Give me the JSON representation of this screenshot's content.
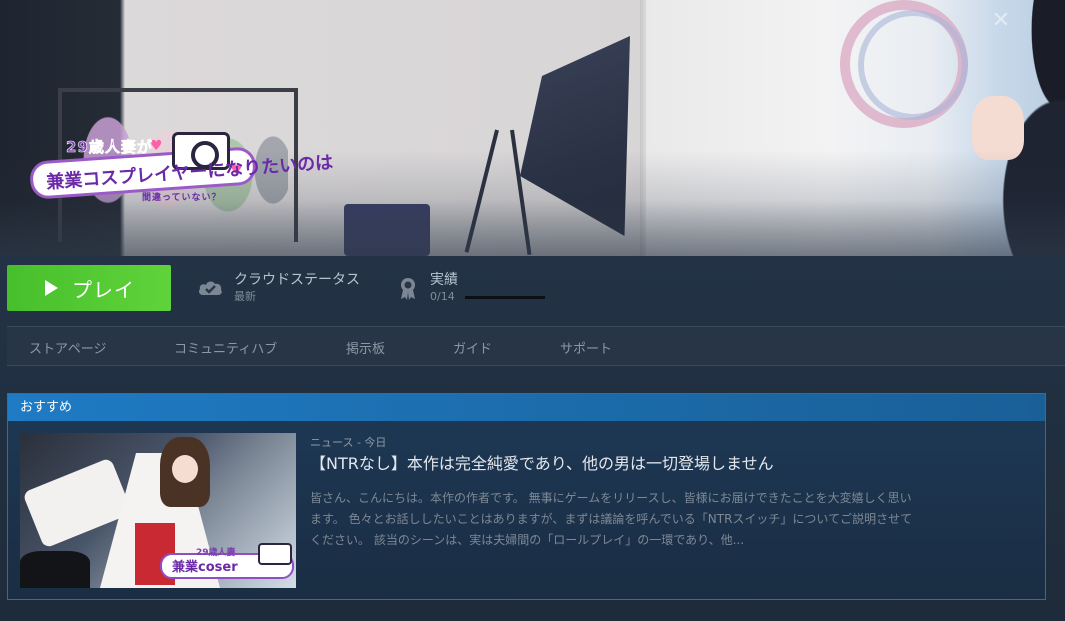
{
  "hero": {
    "close_icon": "close-icon",
    "logo": {
      "line1": "29歳人妻が",
      "line2": "兼業コスプレイヤーになりたいのは",
      "line3": "間違っていない？"
    }
  },
  "actions": {
    "play_label": "プレイ",
    "play_icon": "play-icon",
    "cloud_status_label": "クラウドステータス",
    "cloud_status_value": "最新",
    "cloud_icon": "cloud-check-icon",
    "achievements_label": "実績",
    "achievements_value": "0/14",
    "achievements_progress": 0,
    "achievements_icon": "achievement-badge-icon"
  },
  "tabs": [
    {
      "label": "ストアページ"
    },
    {
      "label": "コミュニティハブ"
    },
    {
      "label": "掲示板"
    },
    {
      "label": "ガイド"
    },
    {
      "label": "サポート"
    }
  ],
  "featured": {
    "header": "おすすめ",
    "thumbnail_logo": {
      "line1": "29歳人妻",
      "line2": "兼業coser"
    },
    "meta": "ニュース - 今日",
    "title": "【NTRなし】本作は完全純愛であり、他の男は一切登場しません",
    "body": "皆さん、こんにちは。本作の作者です。 無事にゲームをリリースし、皆様にお届けできたことを大変嬉しく思います。 色々とお話ししたいことはありますが、まずは議論を呼んでいる「NTRスイッチ」についてご説明させてください。 該当のシーンは、実は夫婦間の「ロールプレイ」の一環であり、他..."
  },
  "colors": {
    "play_green": "#5fd33a",
    "accent_blue": "#1f7bc4",
    "background": "#1b2838"
  }
}
